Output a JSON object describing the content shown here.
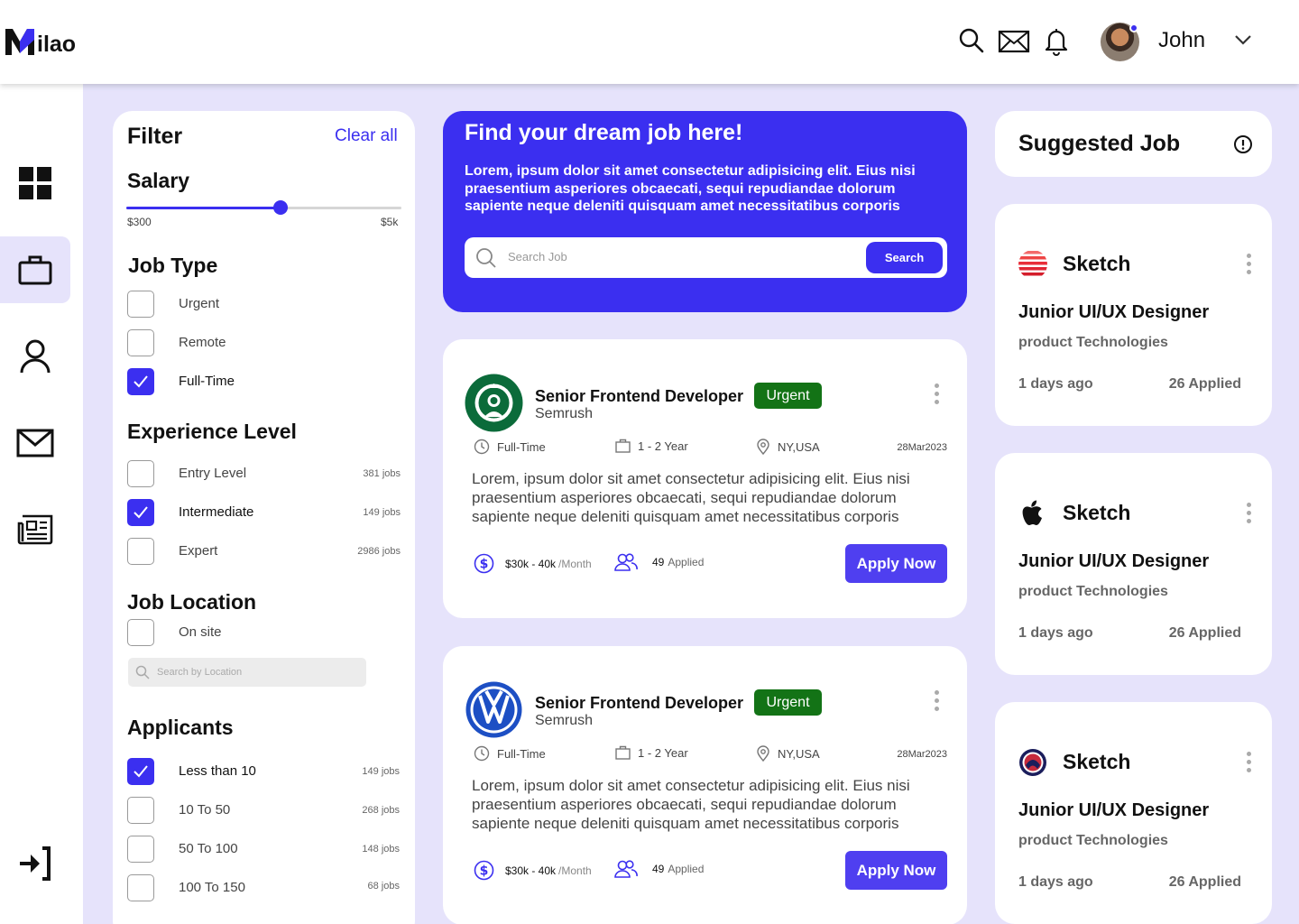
{
  "brand": {
    "logo_text": "ilao",
    "accent": "#3b2ff0"
  },
  "header": {
    "user_name": "John",
    "icons": [
      "search-icon",
      "mail-icon",
      "bell-icon"
    ]
  },
  "nav": {
    "items": [
      "dashboard-icon",
      "briefcase-icon",
      "user-icon",
      "mail-icon",
      "news-icon"
    ],
    "active": "briefcase-icon",
    "logout": "logout-icon"
  },
  "filter": {
    "title": "Filter",
    "clear_all": "Clear all",
    "salary": {
      "heading": "Salary",
      "min_label": "$300",
      "max_label": "$5k",
      "level": 0.56
    },
    "job_type": {
      "heading": "Job Type",
      "options": [
        {
          "label": "Urgent",
          "checked": false
        },
        {
          "label": "Remote",
          "checked": false
        },
        {
          "label": "Full-Time",
          "checked": true
        }
      ]
    },
    "experience": {
      "heading": "Experience Level",
      "options": [
        {
          "label": "Entry Level",
          "count": "381 jobs",
          "checked": false
        },
        {
          "label": "Intermediate",
          "count": "149 jobs",
          "checked": true
        },
        {
          "label": "Expert",
          "count": "2986 jobs",
          "checked": false
        }
      ]
    },
    "location": {
      "heading": "Job Location",
      "option": {
        "label": "On site",
        "checked": false
      },
      "search_placeholder": "Search by Location"
    },
    "applicants": {
      "heading": "Applicants",
      "options": [
        {
          "label": "Less than 10",
          "count": "149 jobs",
          "checked": true
        },
        {
          "label": "10 To 50",
          "count": "268 jobs",
          "checked": false
        },
        {
          "label": "50 To 100",
          "count": "148 jobs",
          "checked": false
        },
        {
          "label": "100 To 150",
          "count": "68 jobs",
          "checked": false
        }
      ]
    }
  },
  "hero": {
    "title": "Find your dream job here!",
    "description": "Lorem, ipsum dolor sit amet consectetur adipisicing elit. Eius nisi praesentium asperiores obcaecati, sequi repudiandae dolorum sapiente neque deleniti quisquam amet necessitatibus corporis",
    "search_placeholder": "Search Job",
    "search_button": "Search"
  },
  "jobs": [
    {
      "logo": "starbucks-logo",
      "title": "Senior Frontend Developer",
      "company": "Semrush",
      "badge": "Urgent",
      "type": "Full-Time",
      "experience": "1 - 2 Year",
      "location": "NY,USA",
      "date": "28Mar2023",
      "description": "Lorem, ipsum dolor sit amet consectetur adipisicing elit. Eius nisi praesentium asperiores obcaecati, sequi repudiandae dolorum sapiente neque deleniti quisquam amet necessitatibus corporis",
      "salary": "$30k - 40k",
      "salary_unit": "/Month",
      "applied_count": "49",
      "applied_label": "Applied",
      "apply_button": "Apply Now"
    },
    {
      "logo": "volkswagen-logo",
      "title": "Senior Frontend Developer",
      "company": "Semrush",
      "badge": "Urgent",
      "type": "Full-Time",
      "experience": "1 - 2 Year",
      "location": "NY,USA",
      "date": "28Mar2023",
      "description": "Lorem, ipsum dolor sit amet consectetur adipisicing elit. Eius nisi praesentium asperiores obcaecati, sequi repudiandae dolorum sapiente neque deleniti quisquam amet necessitatibus corporis",
      "salary": "$30k - 40k",
      "salary_unit": "/Month",
      "applied_count": "49",
      "applied_label": "Applied",
      "apply_button": "Apply Now"
    }
  ],
  "suggested": {
    "title": "Suggested Job",
    "items": [
      {
        "logo": "striped-sphere-logo",
        "brand": "Sketch",
        "role": "Junior UI/UX Designer",
        "company": "product Technologies",
        "posted": "1 days ago",
        "applied": "26 Applied"
      },
      {
        "logo": "apple-logo",
        "brand": "Sketch",
        "role": "Junior UI/UX Designer",
        "company": "product Technologies",
        "posted": "1 days ago",
        "applied": "26 Applied"
      },
      {
        "logo": "circle-emblem-logo",
        "brand": "Sketch",
        "role": "Junior UI/UX Designer",
        "company": "product Technologies",
        "posted": "1 days ago",
        "applied": "26 Applied"
      }
    ]
  }
}
